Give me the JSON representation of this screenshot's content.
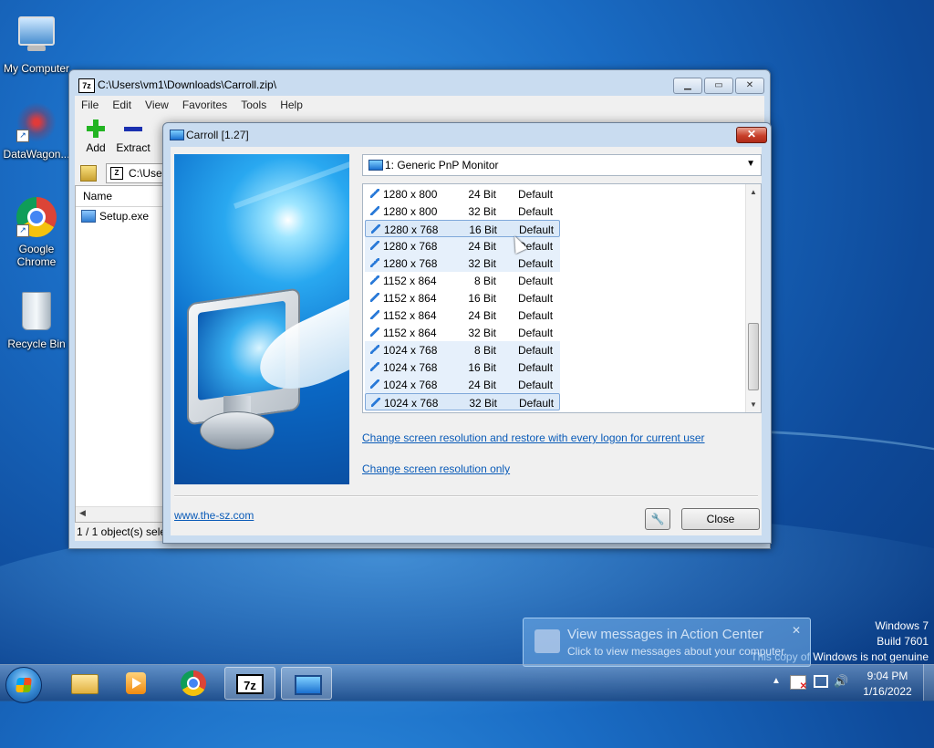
{
  "desktop": {
    "icons": [
      {
        "label": "My Computer"
      },
      {
        "label": "DataWagon..."
      },
      {
        "label": "Google Chrome"
      },
      {
        "label": "Recycle Bin"
      }
    ]
  },
  "sevenzip": {
    "title": "C:\\Users\\vm1\\Downloads\\Carroll.zip\\",
    "app_icon_text": "7z",
    "menu": [
      "File",
      "Edit",
      "View",
      "Favorites",
      "Tools",
      "Help"
    ],
    "toolbar": {
      "add": "Add",
      "extract": "Extract"
    },
    "address": "C:\\User",
    "column_name": "Name",
    "files": [
      {
        "name": "Setup.exe"
      }
    ],
    "status": "1 / 1 object(s) sele"
  },
  "carroll": {
    "title": "Carroll [1.27]",
    "monitor": "1: Generic PnP Monitor",
    "modes": [
      {
        "res": "1280 x 800",
        "bits": "24 Bit",
        "def": "Default"
      },
      {
        "res": "1280 x 800",
        "bits": "32 Bit",
        "def": "Default"
      },
      {
        "res": "1280 x 768",
        "bits": "16 Bit",
        "def": "Default"
      },
      {
        "res": "1280 x 768",
        "bits": "24 Bit",
        "def": "Default"
      },
      {
        "res": "1280 x 768",
        "bits": "32 Bit",
        "def": "Default"
      },
      {
        "res": "1152 x 864",
        "bits": "8 Bit",
        "def": "Default"
      },
      {
        "res": "1152 x 864",
        "bits": "16 Bit",
        "def": "Default"
      },
      {
        "res": "1152 x 864",
        "bits": "24 Bit",
        "def": "Default"
      },
      {
        "res": "1152 x 864",
        "bits": "32 Bit",
        "def": "Default"
      },
      {
        "res": "1024 x 768",
        "bits": "8 Bit",
        "def": "Default"
      },
      {
        "res": "1024 x 768",
        "bits": "16 Bit",
        "def": "Default"
      },
      {
        "res": "1024 x 768",
        "bits": "24 Bit",
        "def": "Default"
      },
      {
        "res": "1024 x 768",
        "bits": "32 Bit",
        "def": "Default"
      }
    ],
    "link_restore": "Change screen resolution and restore with every logon for current user",
    "link_only": "Change screen resolution only",
    "website": "www.the-sz.com",
    "close": "Close"
  },
  "watermark": {
    "line1": "Windows 7",
    "line2": "Build 7601",
    "line3": "This copy of Windows is not genuine"
  },
  "action_center": {
    "title": "View messages in Action Center",
    "subtitle": "Click to view messages about your computer.",
    "close": "✕"
  },
  "taskbar": {
    "time": "9:04 PM",
    "date": "1/16/2022",
    "sevenzip_label": "7z"
  }
}
